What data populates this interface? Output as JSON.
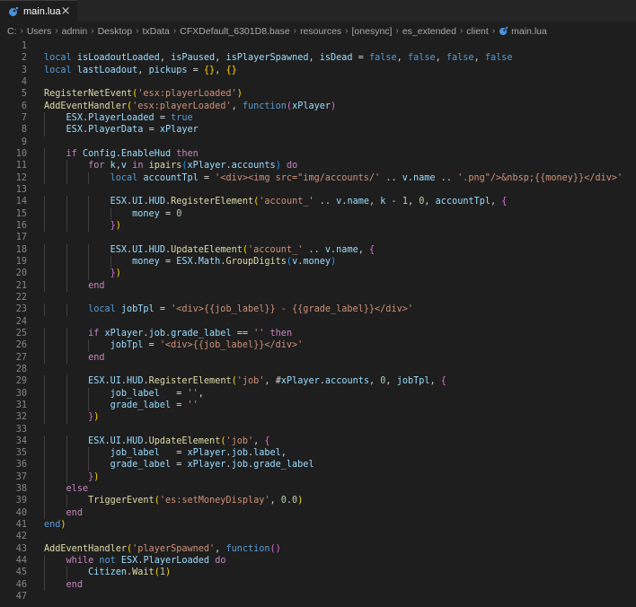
{
  "tab": {
    "label": "main.lua",
    "close": "×"
  },
  "breadcrumb": [
    "C:",
    "Users",
    "admin",
    "Desktop",
    "txData",
    "CFXDefault_6301D8.base",
    "resources",
    "[onesync]",
    "es_extended",
    "client",
    "main.lua"
  ],
  "colors": {
    "editor_bg": "#1e1e1e",
    "keyword": "#569cd6",
    "control": "#c586c0",
    "function": "#dcdcaa",
    "string": "#ce9178",
    "variable": "#9cdcfe",
    "number": "#b5cea8"
  },
  "lines": [
    [],
    [
      [
        "kw",
        "local "
      ],
      [
        "var",
        "isLoadoutLoaded"
      ],
      [
        "op",
        ", "
      ],
      [
        "var",
        "isPaused"
      ],
      [
        "op",
        ", "
      ],
      [
        "var",
        "isPlayerSpawned"
      ],
      [
        "op",
        ", "
      ],
      [
        "var",
        "isDead"
      ],
      [
        "op",
        " = "
      ],
      [
        "kw",
        "false"
      ],
      [
        "op",
        ", "
      ],
      [
        "kw",
        "false"
      ],
      [
        "op",
        ", "
      ],
      [
        "kw",
        "false"
      ],
      [
        "op",
        ", "
      ],
      [
        "kw",
        "false"
      ]
    ],
    [
      [
        "kw",
        "local "
      ],
      [
        "var",
        "lastLoadout"
      ],
      [
        "op",
        ", "
      ],
      [
        "var",
        "pickups"
      ],
      [
        "op",
        " = "
      ],
      [
        "brk1",
        "{}"
      ],
      [
        "op",
        ", "
      ],
      [
        "brk1",
        "{}"
      ]
    ],
    [],
    [
      [
        "fn",
        "RegisterNetEvent"
      ],
      [
        "brk1",
        "("
      ],
      [
        "str",
        "'esx:playerLoaded'"
      ],
      [
        "brk1",
        ")"
      ]
    ],
    [
      [
        "fn",
        "AddEventHandler"
      ],
      [
        "brk1",
        "("
      ],
      [
        "str",
        "'esx:playerLoaded'"
      ],
      [
        "op",
        ", "
      ],
      [
        "kw",
        "function"
      ],
      [
        "brk2",
        "("
      ],
      [
        "var",
        "xPlayer"
      ],
      [
        "brk2",
        ")"
      ]
    ],
    [
      [
        "op",
        "    "
      ],
      [
        "var",
        "ESX"
      ],
      [
        "op",
        "."
      ],
      [
        "var",
        "PlayerLoaded"
      ],
      [
        "op",
        " = "
      ],
      [
        "kw",
        "true"
      ]
    ],
    [
      [
        "op",
        "    "
      ],
      [
        "var",
        "ESX"
      ],
      [
        "op",
        "."
      ],
      [
        "var",
        "PlayerData"
      ],
      [
        "op",
        " = "
      ],
      [
        "var",
        "xPlayer"
      ]
    ],
    [],
    [
      [
        "op",
        "    "
      ],
      [
        "ctl",
        "if "
      ],
      [
        "var",
        "Config"
      ],
      [
        "op",
        "."
      ],
      [
        "var",
        "EnableHud"
      ],
      [
        "ctl",
        " then"
      ]
    ],
    [
      [
        "op",
        "        "
      ],
      [
        "ctl",
        "for "
      ],
      [
        "var",
        "k"
      ],
      [
        "op",
        ","
      ],
      [
        "var",
        "v"
      ],
      [
        "ctl",
        " in "
      ],
      [
        "fn",
        "ipairs"
      ],
      [
        "brk3",
        "("
      ],
      [
        "var",
        "xPlayer"
      ],
      [
        "op",
        "."
      ],
      [
        "var",
        "accounts"
      ],
      [
        "brk3",
        ")"
      ],
      [
        "ctl",
        " do"
      ]
    ],
    [
      [
        "op",
        "            "
      ],
      [
        "kw",
        "local "
      ],
      [
        "var",
        "accountTpl"
      ],
      [
        "op",
        " = "
      ],
      [
        "str",
        "'<div><img src=\"img/accounts/'"
      ],
      [
        "op",
        " .. "
      ],
      [
        "var",
        "v"
      ],
      [
        "op",
        "."
      ],
      [
        "var",
        "name"
      ],
      [
        "op",
        " .. "
      ],
      [
        "str",
        "'.png\"/>&nbsp;{{money}}</div>'"
      ]
    ],
    [],
    [
      [
        "op",
        "            "
      ],
      [
        "var",
        "ESX"
      ],
      [
        "op",
        "."
      ],
      [
        "var",
        "UI"
      ],
      [
        "op",
        "."
      ],
      [
        "var",
        "HUD"
      ],
      [
        "op",
        "."
      ],
      [
        "fn",
        "RegisterElement"
      ],
      [
        "brk1",
        "("
      ],
      [
        "str",
        "'account_'"
      ],
      [
        "op",
        " .. "
      ],
      [
        "var",
        "v"
      ],
      [
        "op",
        "."
      ],
      [
        "var",
        "name"
      ],
      [
        "op",
        ", "
      ],
      [
        "var",
        "k"
      ],
      [
        "op",
        " - "
      ],
      [
        "num",
        "1"
      ],
      [
        "op",
        ", "
      ],
      [
        "num",
        "0"
      ],
      [
        "op",
        ", "
      ],
      [
        "var",
        "accountTpl"
      ],
      [
        "op",
        ", "
      ],
      [
        "brk2",
        "{"
      ]
    ],
    [
      [
        "op",
        "                "
      ],
      [
        "var",
        "money"
      ],
      [
        "op",
        " = "
      ],
      [
        "num",
        "0"
      ]
    ],
    [
      [
        "op",
        "            "
      ],
      [
        "brk2",
        "}"
      ],
      [
        "brk1",
        ")"
      ]
    ],
    [],
    [
      [
        "op",
        "            "
      ],
      [
        "var",
        "ESX"
      ],
      [
        "op",
        "."
      ],
      [
        "var",
        "UI"
      ],
      [
        "op",
        "."
      ],
      [
        "var",
        "HUD"
      ],
      [
        "op",
        "."
      ],
      [
        "fn",
        "UpdateElement"
      ],
      [
        "brk1",
        "("
      ],
      [
        "str",
        "'account_'"
      ],
      [
        "op",
        " .. "
      ],
      [
        "var",
        "v"
      ],
      [
        "op",
        "."
      ],
      [
        "var",
        "name"
      ],
      [
        "op",
        ", "
      ],
      [
        "brk2",
        "{"
      ]
    ],
    [
      [
        "op",
        "                "
      ],
      [
        "var",
        "money"
      ],
      [
        "op",
        " = "
      ],
      [
        "var",
        "ESX"
      ],
      [
        "op",
        "."
      ],
      [
        "var",
        "Math"
      ],
      [
        "op",
        "."
      ],
      [
        "fn",
        "GroupDigits"
      ],
      [
        "brk3",
        "("
      ],
      [
        "var",
        "v"
      ],
      [
        "op",
        "."
      ],
      [
        "var",
        "money"
      ],
      [
        "brk3",
        ")"
      ]
    ],
    [
      [
        "op",
        "            "
      ],
      [
        "brk2",
        "}"
      ],
      [
        "brk1",
        ")"
      ]
    ],
    [
      [
        "op",
        "        "
      ],
      [
        "ctl",
        "end"
      ]
    ],
    [],
    [
      [
        "op",
        "        "
      ],
      [
        "kw",
        "local "
      ],
      [
        "var",
        "jobTpl"
      ],
      [
        "op",
        " = "
      ],
      [
        "str",
        "'<div>{{job_label}} - {{grade_label}}</div>'"
      ]
    ],
    [],
    [
      [
        "op",
        "        "
      ],
      [
        "ctl",
        "if "
      ],
      [
        "var",
        "xPlayer"
      ],
      [
        "op",
        "."
      ],
      [
        "var",
        "job"
      ],
      [
        "op",
        "."
      ],
      [
        "var",
        "grade_label"
      ],
      [
        "op",
        " == "
      ],
      [
        "str",
        "''"
      ],
      [
        "ctl",
        " then"
      ]
    ],
    [
      [
        "op",
        "            "
      ],
      [
        "var",
        "jobTpl"
      ],
      [
        "op",
        " = "
      ],
      [
        "str",
        "'<div>{{job_label}}</div>'"
      ]
    ],
    [
      [
        "op",
        "        "
      ],
      [
        "ctl",
        "end"
      ]
    ],
    [],
    [
      [
        "op",
        "        "
      ],
      [
        "var",
        "ESX"
      ],
      [
        "op",
        "."
      ],
      [
        "var",
        "UI"
      ],
      [
        "op",
        "."
      ],
      [
        "var",
        "HUD"
      ],
      [
        "op",
        "."
      ],
      [
        "fn",
        "RegisterElement"
      ],
      [
        "brk1",
        "("
      ],
      [
        "str",
        "'job'"
      ],
      [
        "op",
        ", "
      ],
      [
        "op",
        "#"
      ],
      [
        "var",
        "xPlayer"
      ],
      [
        "op",
        "."
      ],
      [
        "var",
        "accounts"
      ],
      [
        "op",
        ", "
      ],
      [
        "num",
        "0"
      ],
      [
        "op",
        ", "
      ],
      [
        "var",
        "jobTpl"
      ],
      [
        "op",
        ", "
      ],
      [
        "brk2",
        "{"
      ]
    ],
    [
      [
        "op",
        "            "
      ],
      [
        "var",
        "job_label"
      ],
      [
        "op",
        "   = "
      ],
      [
        "str",
        "''"
      ],
      [
        "op",
        ","
      ]
    ],
    [
      [
        "op",
        "            "
      ],
      [
        "var",
        "grade_label"
      ],
      [
        "op",
        " = "
      ],
      [
        "str",
        "''"
      ]
    ],
    [
      [
        "op",
        "        "
      ],
      [
        "brk2",
        "}"
      ],
      [
        "brk1",
        ")"
      ]
    ],
    [],
    [
      [
        "op",
        "        "
      ],
      [
        "var",
        "ESX"
      ],
      [
        "op",
        "."
      ],
      [
        "var",
        "UI"
      ],
      [
        "op",
        "."
      ],
      [
        "var",
        "HUD"
      ],
      [
        "op",
        "."
      ],
      [
        "fn",
        "UpdateElement"
      ],
      [
        "brk1",
        "("
      ],
      [
        "str",
        "'job'"
      ],
      [
        "op",
        ", "
      ],
      [
        "brk2",
        "{"
      ]
    ],
    [
      [
        "op",
        "            "
      ],
      [
        "var",
        "job_label"
      ],
      [
        "op",
        "   = "
      ],
      [
        "var",
        "xPlayer"
      ],
      [
        "op",
        "."
      ],
      [
        "var",
        "job"
      ],
      [
        "op",
        "."
      ],
      [
        "var",
        "label"
      ],
      [
        "op",
        ","
      ]
    ],
    [
      [
        "op",
        "            "
      ],
      [
        "var",
        "grade_label"
      ],
      [
        "op",
        " = "
      ],
      [
        "var",
        "xPlayer"
      ],
      [
        "op",
        "."
      ],
      [
        "var",
        "job"
      ],
      [
        "op",
        "."
      ],
      [
        "var",
        "grade_label"
      ]
    ],
    [
      [
        "op",
        "        "
      ],
      [
        "brk2",
        "}"
      ],
      [
        "brk1",
        ")"
      ]
    ],
    [
      [
        "op",
        "    "
      ],
      [
        "ctl",
        "else"
      ]
    ],
    [
      [
        "op",
        "        "
      ],
      [
        "fn",
        "TriggerEvent"
      ],
      [
        "brk1",
        "("
      ],
      [
        "str",
        "'es:setMoneyDisplay'"
      ],
      [
        "op",
        ", "
      ],
      [
        "num",
        "0.0"
      ],
      [
        "brk1",
        ")"
      ]
    ],
    [
      [
        "op",
        "    "
      ],
      [
        "ctl",
        "end"
      ]
    ],
    [
      [
        "kw",
        "end"
      ],
      [
        "brk1",
        ")"
      ]
    ],
    [],
    [
      [
        "fn",
        "AddEventHandler"
      ],
      [
        "brk1",
        "("
      ],
      [
        "str",
        "'playerSpawned'"
      ],
      [
        "op",
        ", "
      ],
      [
        "kw",
        "function"
      ],
      [
        "brk2",
        "()"
      ]
    ],
    [
      [
        "op",
        "    "
      ],
      [
        "ctl",
        "while "
      ],
      [
        "kw",
        "not "
      ],
      [
        "var",
        "ESX"
      ],
      [
        "op",
        "."
      ],
      [
        "var",
        "PlayerLoaded"
      ],
      [
        "ctl",
        " do"
      ]
    ],
    [
      [
        "op",
        "        "
      ],
      [
        "var",
        "Citizen"
      ],
      [
        "op",
        "."
      ],
      [
        "fn",
        "Wait"
      ],
      [
        "brk1",
        "("
      ],
      [
        "num",
        "1"
      ],
      [
        "brk1",
        ")"
      ]
    ],
    [
      [
        "op",
        "    "
      ],
      [
        "ctl",
        "end"
      ]
    ],
    []
  ]
}
